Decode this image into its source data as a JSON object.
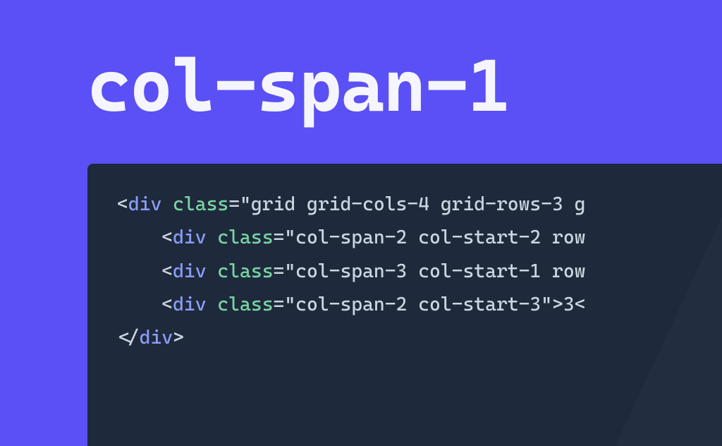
{
  "title": "col-span-1",
  "code": {
    "line1": {
      "open": "<",
      "tag": "div",
      "space1": " ",
      "attr": "class",
      "eq": "=",
      "q1": "\"",
      "str": "grid grid-cols-4 grid-rows-3 g",
      "tail": ""
    },
    "line2": {
      "indent": "    ",
      "open": "<",
      "tag": "div",
      "space1": " ",
      "attr": "class",
      "eq": "=",
      "q1": "\"",
      "str": "col-span-2 col-start-2 row",
      "tail": ""
    },
    "line3": {
      "indent": "    ",
      "open": "<",
      "tag": "div",
      "space1": " ",
      "attr": "class",
      "eq": "=",
      "q1": "\"",
      "str": "col-span-3 col-start-1 row",
      "tail": ""
    },
    "line4": {
      "indent": "    ",
      "open": "<",
      "tag": "div",
      "space1": " ",
      "attr": "class",
      "eq": "=",
      "q1": "\"",
      "str": "col-span-2 col-start-3",
      "q2": "\"",
      "gt": ">",
      "txt": "3",
      "lt2": "<"
    },
    "line5": {
      "open": "</",
      "tag": "div",
      "close": ">"
    }
  }
}
